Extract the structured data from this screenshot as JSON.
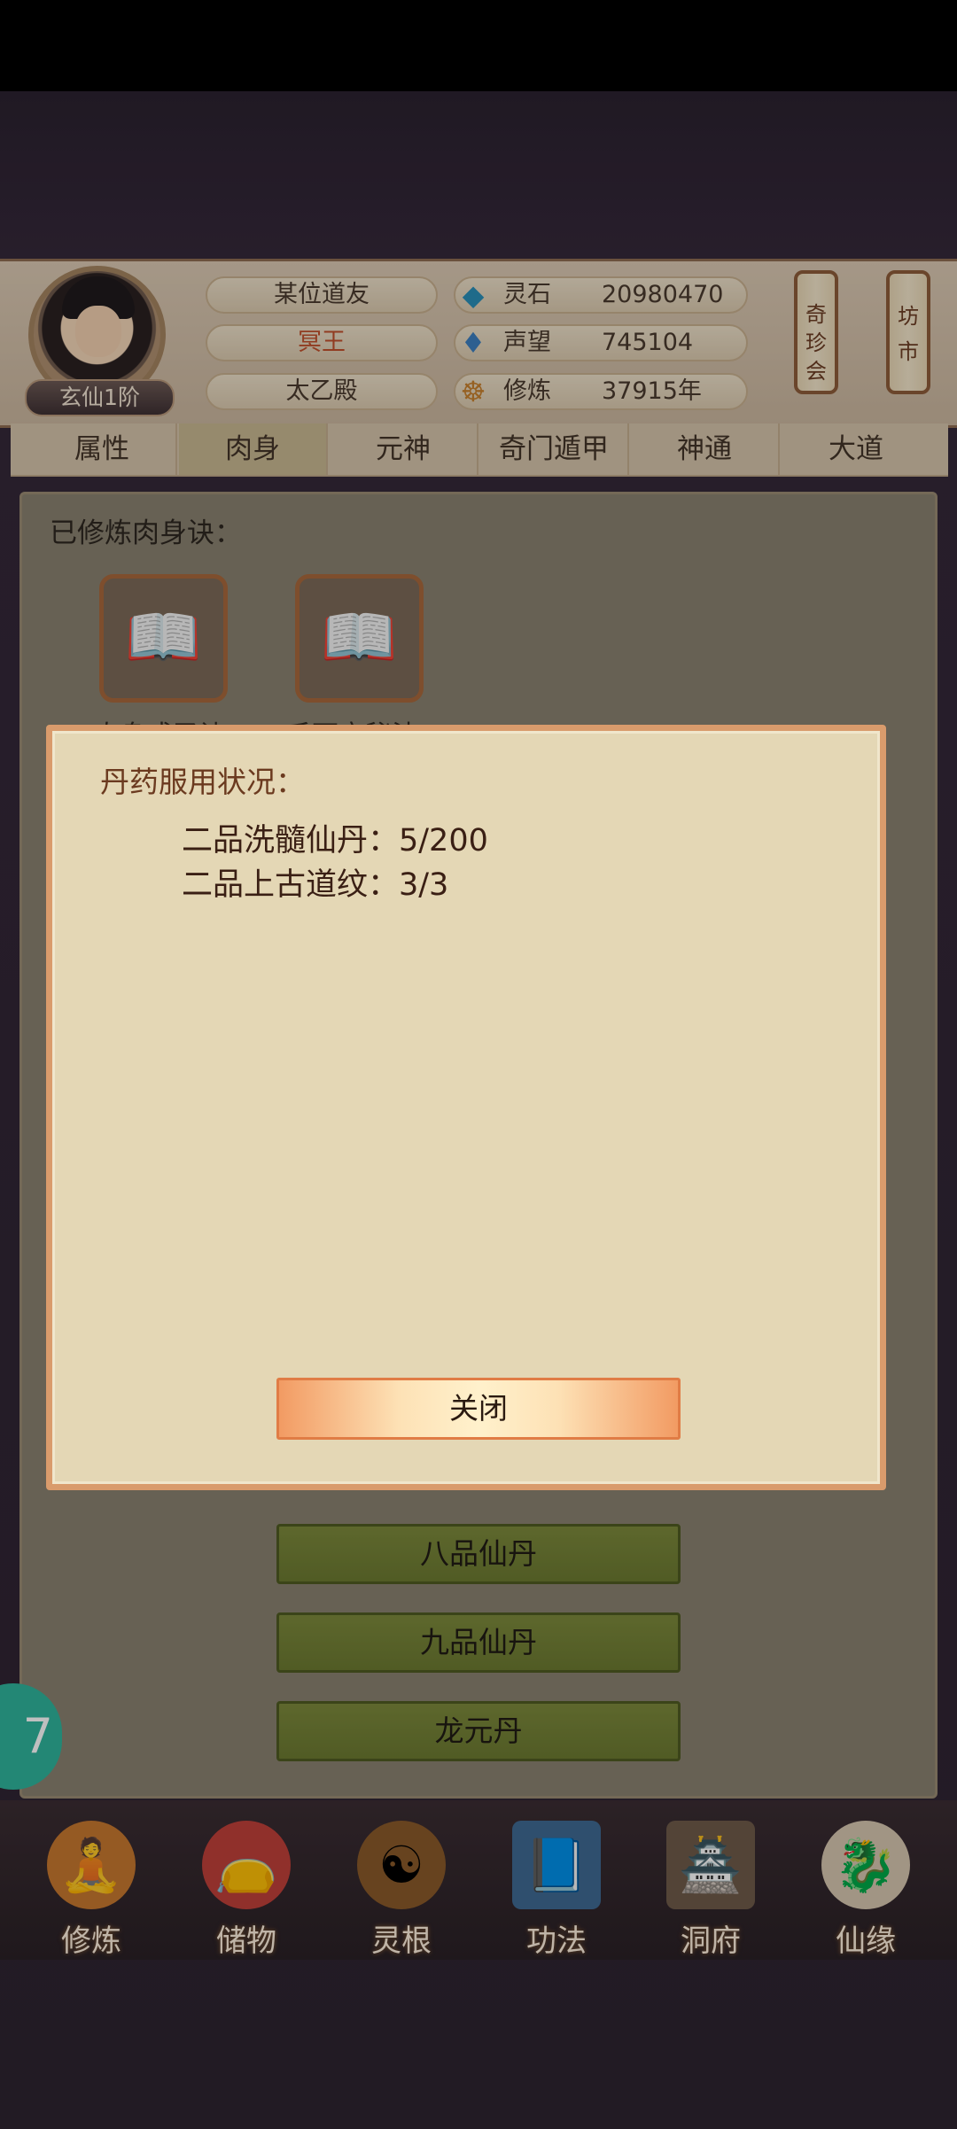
{
  "header": {
    "rank": "玄仙1阶",
    "name_pills": [
      "某位道友",
      "冥王",
      "太乙殿"
    ],
    "stats": [
      {
        "icon": "spirit-stone-icon",
        "label": "灵石",
        "value": "20980470"
      },
      {
        "icon": "reputation-icon",
        "label": "声望",
        "value": "745104"
      },
      {
        "icon": "cultivation-icon",
        "label": "修炼",
        "value": "37915年"
      }
    ],
    "qizhenhui": "奇珍会",
    "fangshi": "坊市"
  },
  "tabs": [
    "属性",
    "肉身",
    "元神",
    "奇门遁甲",
    "神通",
    "大道"
  ],
  "active_tab": "肉身",
  "content": {
    "learned_label": "已修炼肉身诀：",
    "books": [
      "肉身成圣诀",
      "千面宝秘法"
    ],
    "pill_buttons": [
      "八品仙丹",
      "九品仙丹",
      "龙元丹"
    ]
  },
  "modal": {
    "title": "丹药服用状况：",
    "lines": [
      "二品洗髓仙丹：5/200",
      "二品上古道纹：3/3"
    ],
    "close_label": "关闭"
  },
  "bottom_nav": [
    {
      "label": "修炼",
      "icon": "cultivate-icon"
    },
    {
      "label": "储物",
      "icon": "storage-bag-icon"
    },
    {
      "label": "灵根",
      "icon": "spirit-root-icon"
    },
    {
      "label": "功法",
      "icon": "technique-book-icon"
    },
    {
      "label": "洞府",
      "icon": "cave-dwelling-icon"
    },
    {
      "label": "仙缘",
      "icon": "fate-icon"
    }
  ],
  "float_badge": "7"
}
